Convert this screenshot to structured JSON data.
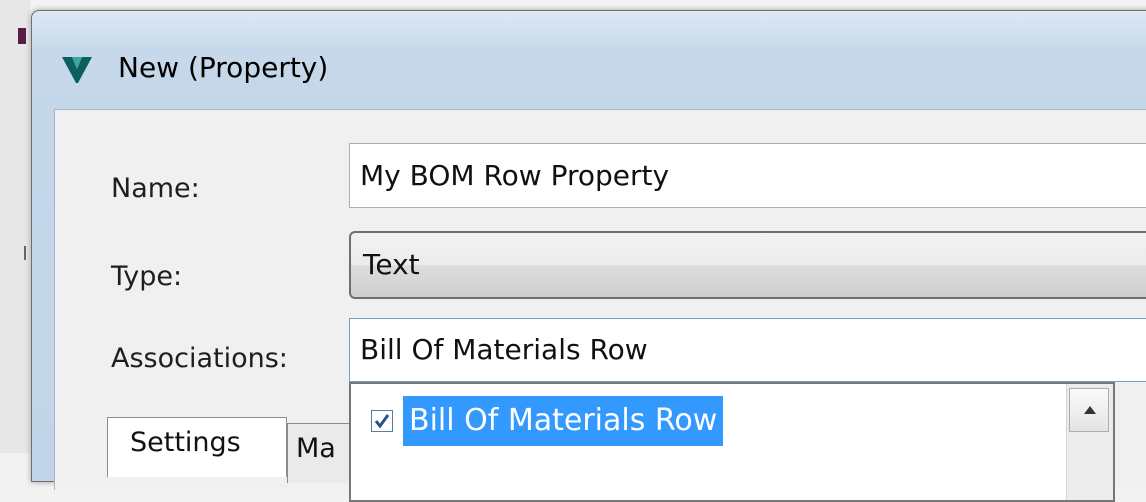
{
  "window": {
    "title": "New (Property)",
    "icon": "vault-logo-icon"
  },
  "form": {
    "name_label": "Name:",
    "name_value": "My BOM Row Property",
    "type_label": "Type:",
    "type_value": "Text",
    "associations_label": "Associations:",
    "associations_value": "Bill Of Materials Row"
  },
  "tabs": [
    {
      "label": "Settings"
    },
    {
      "label": "Ma"
    }
  ],
  "dropdown": {
    "items": [
      {
        "label": "Bill Of Materials Row",
        "checked": true,
        "selected": true
      }
    ]
  },
  "colors": {
    "selection": "#3399ff",
    "logo": "#0b5f5f"
  }
}
